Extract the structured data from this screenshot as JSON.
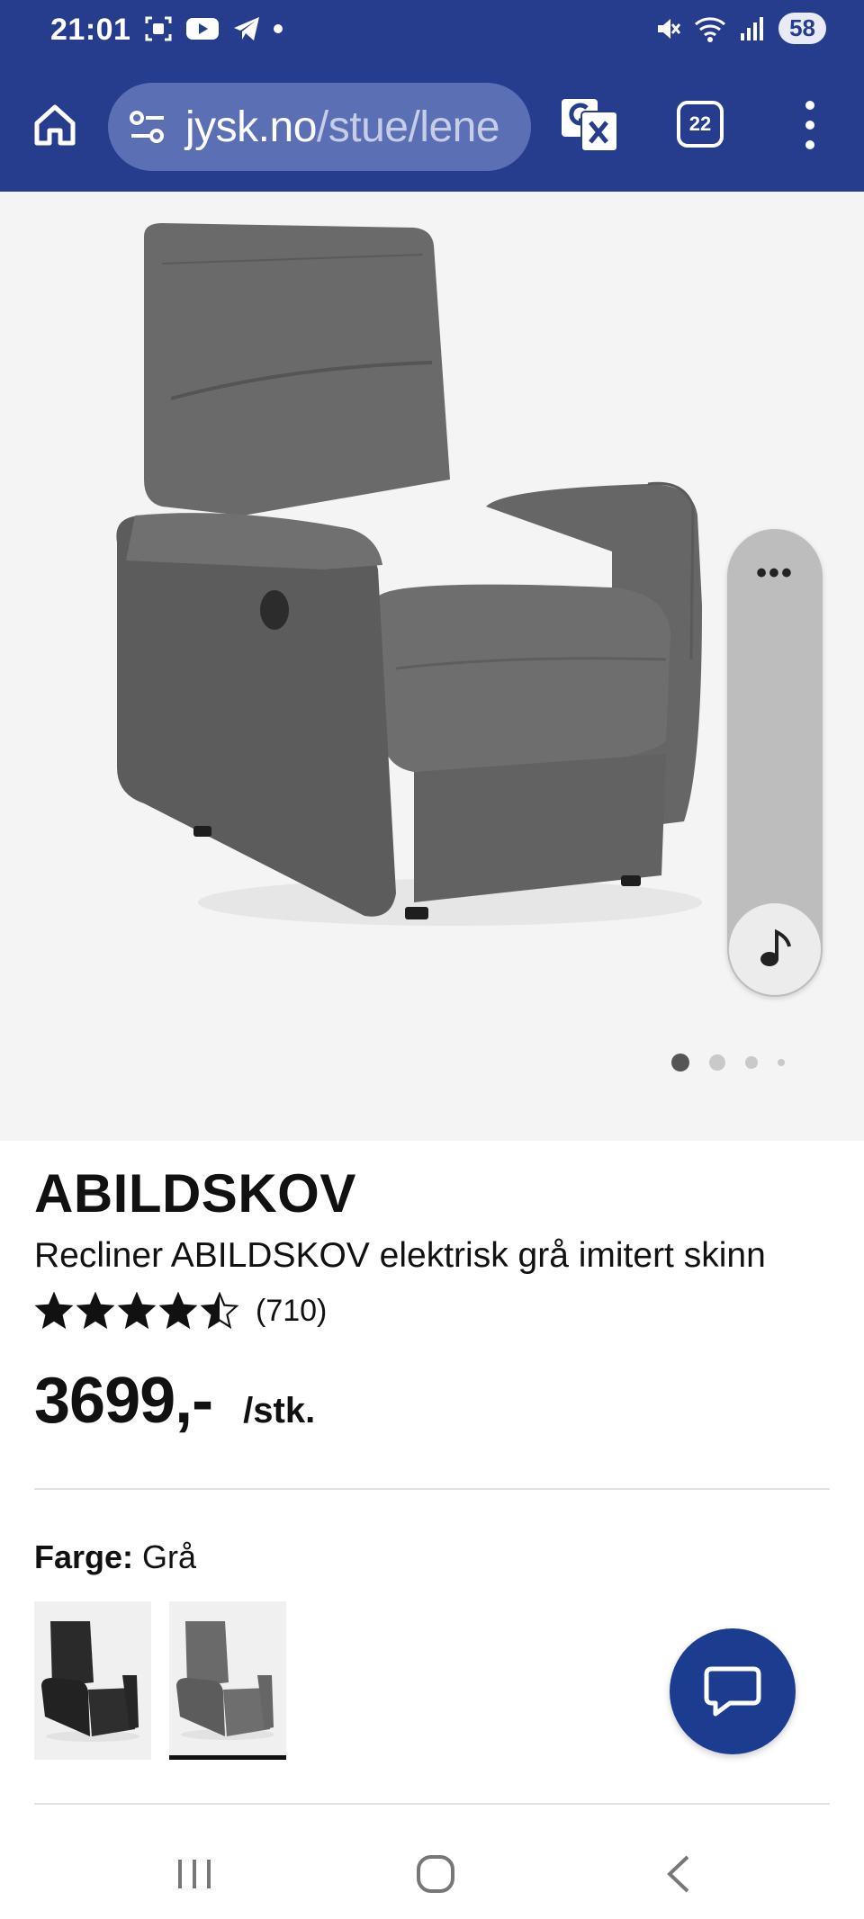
{
  "status_bar": {
    "time": "21:01",
    "battery": "58",
    "left_icons": [
      "screenshot-icon",
      "youtube-icon",
      "telegram-icon",
      "dot-icon"
    ],
    "right_icons": [
      "mute-icon",
      "wifi-icon",
      "signal-icon"
    ]
  },
  "browser": {
    "url_host": "jysk.no",
    "url_path": "/stue/lene",
    "tab_count": "22"
  },
  "gallery": {
    "image_count": 4,
    "active_index": 0,
    "side_panel_more": "•••"
  },
  "product": {
    "brand": "ABILDSKOV",
    "name": "Recliner ABILDSKOV elektrisk grå imitert skinn",
    "rating_value": 4.5,
    "rating_count": "(710)",
    "price": "3699,-",
    "unit": "/stk.",
    "colour_label": "Farge:",
    "colour_value": "Grå",
    "swatches": [
      {
        "name": "black",
        "selected": false,
        "color": "#2a2a2a"
      },
      {
        "name": "grey",
        "selected": true,
        "color": "#5e5e5e"
      }
    ]
  },
  "colors": {
    "chrome": "#263d8e",
    "chat_button": "#1b3c8f",
    "urlbar": "#5b6fb5"
  }
}
